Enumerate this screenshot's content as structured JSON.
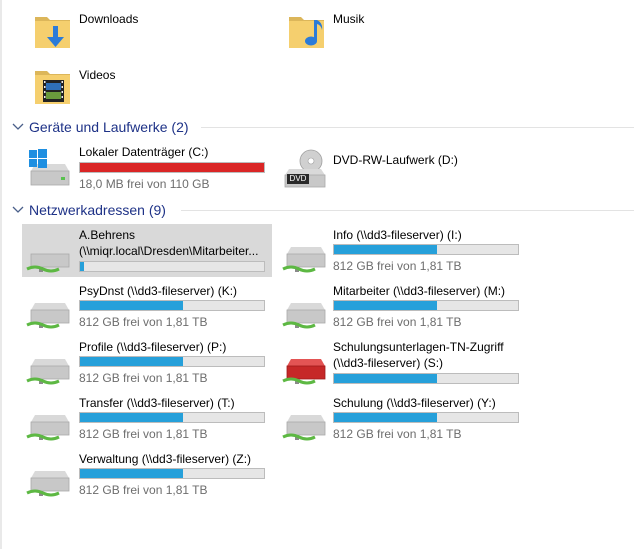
{
  "folders": [
    {
      "name": "Downloads",
      "icon": "downloads-folder-icon"
    },
    {
      "name": "Musik",
      "icon": "music-folder-icon"
    },
    {
      "name": "Videos",
      "icon": "videos-folder-icon"
    }
  ],
  "devices_section": {
    "label": "Geräte und Laufwerke (2)"
  },
  "devices": [
    {
      "name": "Lokaler Datenträger (C:)",
      "free": "18,0 MB frei von 110 GB",
      "used_fraction": 0.998,
      "bar_color": "#da2626",
      "icon": "windows-drive-icon"
    },
    {
      "name": "DVD-RW-Laufwerk (D:)",
      "icon": "dvd-drive-icon",
      "dvd_label": "DVD"
    }
  ],
  "network_section": {
    "label": "Netzwerkadressen (9)"
  },
  "network": [
    {
      "line1": "A.Behrens",
      "line2": "(\\\\miqr.local\\Dresden\\Mitarbeiter...",
      "used_fraction": 0.02,
      "bar_color": "#26a0da",
      "icon": "network-drive-icon"
    },
    {
      "name": "Info (\\\\dd3-fileserver) (I:)",
      "free": "812 GB frei von 1,81 TB",
      "used_fraction": 0.56,
      "bar_color": "#26a0da",
      "icon": "network-drive-icon"
    },
    {
      "name": "PsyDnst (\\\\dd3-fileserver) (K:)",
      "free": "812 GB frei von 1,81 TB",
      "used_fraction": 0.56,
      "bar_color": "#26a0da",
      "icon": "network-drive-icon"
    },
    {
      "name": "Mitarbeiter (\\\\dd3-fileserver) (M:)",
      "free": "812 GB frei von 1,81 TB",
      "used_fraction": 0.56,
      "bar_color": "#26a0da",
      "icon": "network-drive-icon"
    },
    {
      "name": "Profile (\\\\dd3-fileserver) (P:)",
      "free": "812 GB frei von 1,81 TB",
      "used_fraction": 0.56,
      "bar_color": "#26a0da",
      "icon": "network-drive-icon"
    },
    {
      "line1": "Schulungsunterlagen-TN-Zugriff",
      "line2": "(\\\\dd3-fileserver) (S:)",
      "used_fraction": 0.56,
      "bar_color": "#26a0da",
      "icon": "network-drive-red-icon"
    },
    {
      "name": "Transfer (\\\\dd3-fileserver) (T:)",
      "free": "812 GB frei von 1,81 TB",
      "used_fraction": 0.56,
      "bar_color": "#26a0da",
      "icon": "network-drive-icon"
    },
    {
      "name": "Schulung (\\\\dd3-fileserver) (Y:)",
      "free": "812 GB frei von 1,81 TB",
      "used_fraction": 0.56,
      "bar_color": "#26a0da",
      "icon": "network-drive-icon"
    },
    {
      "name": "Verwaltung (\\\\dd3-fileserver) (Z:)",
      "free": "812 GB frei von 1,81 TB",
      "used_fraction": 0.56,
      "bar_color": "#26a0da",
      "icon": "network-drive-icon"
    }
  ]
}
